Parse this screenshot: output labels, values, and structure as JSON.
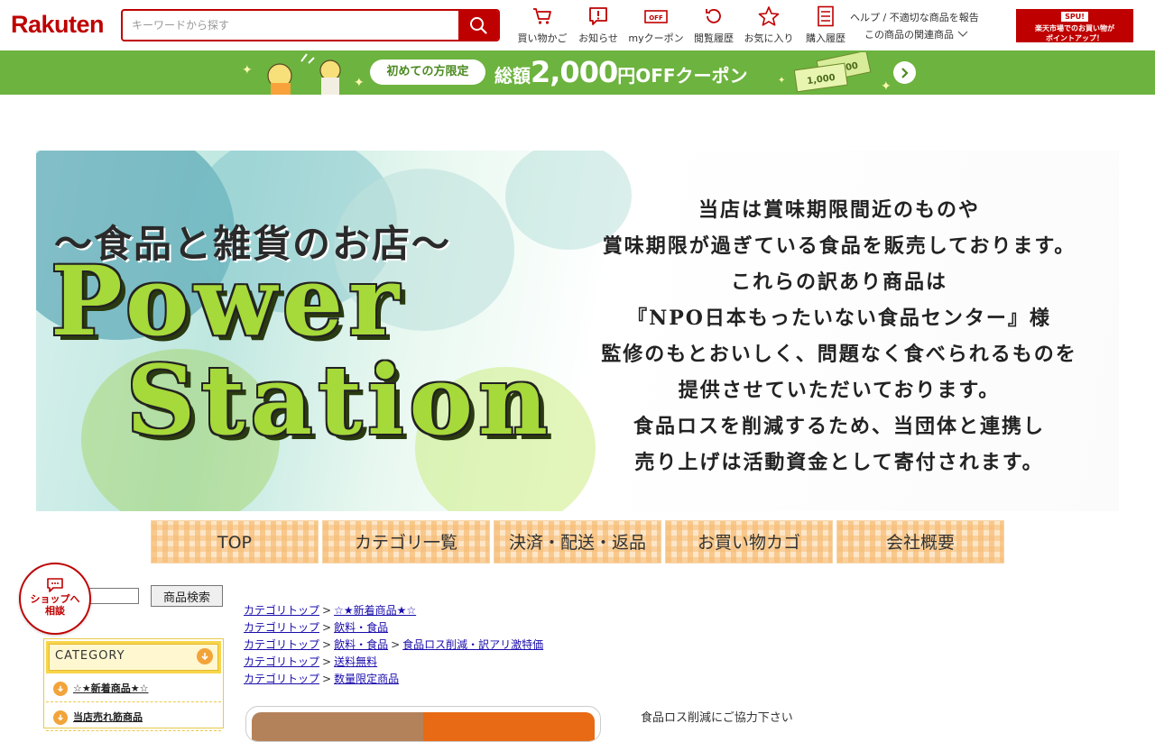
{
  "header": {
    "logo": "Rakuten",
    "search_placeholder": "キーワードから探す",
    "nav": [
      {
        "label": "買い物かご",
        "icon": "cart-icon"
      },
      {
        "label": "お知らせ",
        "icon": "notice-icon"
      },
      {
        "label": "myクーポン",
        "icon": "coupon-icon"
      },
      {
        "label": "閲覧履歴",
        "icon": "history-icon"
      },
      {
        "label": "お気に入り",
        "icon": "star-icon"
      },
      {
        "label": "購入履歴",
        "icon": "purchase-history-icon"
      }
    ],
    "help_link": "ヘルプ / 不適切な商品を報告",
    "related_link": "この商品の関連商品",
    "spu_top": "SPU!",
    "spu_line1": "楽天市場でのお買い物が",
    "spu_line2": "ポイントアップ！"
  },
  "coupon": {
    "pill": "初めての方限定",
    "prefix": "総額",
    "amount": "2,000",
    "suffix": "円OFFクーポン",
    "bill1": "1,000",
    "bill2": "1,000"
  },
  "banner": {
    "tagline": "～食品と雑貨のお店～",
    "brand1": "Power",
    "brand2": "Station",
    "desc": [
      "当店は賞味期限間近のものや",
      "賞味期限が過ぎている食品を販売しております。",
      "これらの訳あり商品は",
      "『NPO日本もったいない食品センター』様",
      "監修のもとおいしく、問題なく食べられるものを",
      "提供させていただいております。",
      "食品ロスを削減するため、当団体と連携し",
      "売り上げは活動資金として寄付されます。"
    ]
  },
  "shop_nav": [
    "TOP",
    "カテゴリ一覧",
    "決済・配送・返品",
    "お買い物カゴ",
    "会社概要"
  ],
  "sidebar": {
    "chat_line1": "ショップへ",
    "chat_line2": "相談",
    "search_button": "商品検索",
    "category_title": "CATEGORY",
    "categories": [
      "☆★新着商品★☆",
      "当店売れ筋商品"
    ]
  },
  "breadcrumbs": [
    [
      "カテゴリトップ",
      "☆★新着商品★☆"
    ],
    [
      "カテゴリトップ",
      "飲料・食品"
    ],
    [
      "カテゴリトップ",
      "飲料・食品",
      "食品ロス削減・訳アリ激特価"
    ],
    [
      "カテゴリトップ",
      "送料無料"
    ],
    [
      "カテゴリトップ",
      "数量限定商品"
    ]
  ],
  "breadcrumb_sep": ">",
  "content": {
    "note": "食品ロス削減にご協力下さい"
  },
  "colors": {
    "brand_red": "#bf0000",
    "coupon_green": "#6db33f",
    "tab_orange": "#f6be78",
    "category_yellow": "#f7d64a"
  }
}
